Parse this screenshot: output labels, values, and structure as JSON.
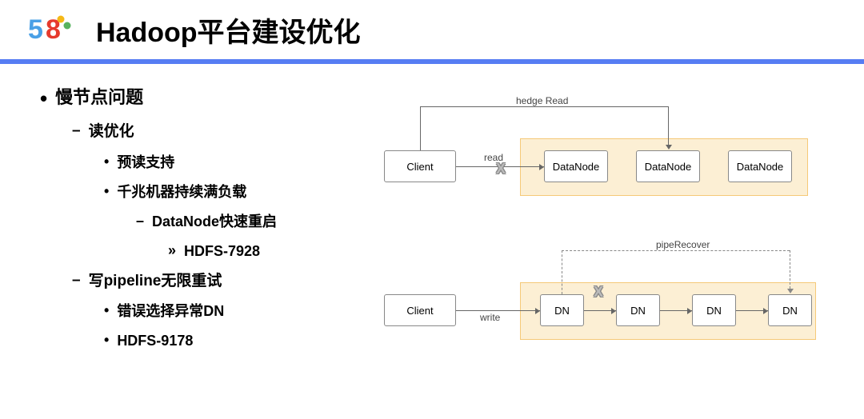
{
  "title": "Hadoop平台建设优化",
  "logo": {
    "five": "5",
    "eight": "8"
  },
  "outline": {
    "l1": "慢节点问题",
    "l2a": "读优化",
    "l3a": "预读支持",
    "l3b": "千兆机器持续满负载",
    "l4a": "DataNode快速重启",
    "l5a": "HDFS-7928",
    "l2b": "写pipeline无限重试",
    "l3c": "错误选择异常DN",
    "l3d": "HDFS-9178"
  },
  "diagram1": {
    "client": "Client",
    "read": "read",
    "hedge": "hedge Read",
    "dn1": "DataNode",
    "dn2": "DataNode",
    "dn3": "DataNode",
    "x": "X"
  },
  "diagram2": {
    "client": "Client",
    "write": "write",
    "pipe": "pipeRecover",
    "dn": "DN",
    "x": "X"
  }
}
